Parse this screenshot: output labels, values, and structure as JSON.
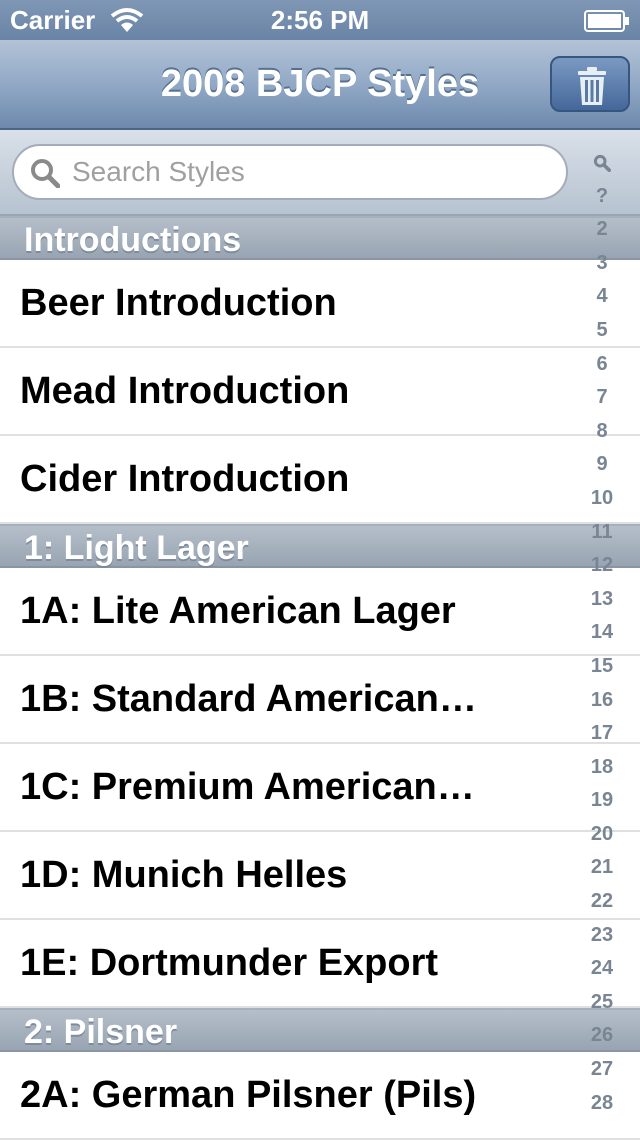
{
  "status_bar": {
    "carrier": "Carrier",
    "time": "2:56 PM"
  },
  "nav": {
    "title": "2008 BJCP Styles",
    "trash_icon": "trash-icon"
  },
  "search": {
    "placeholder": "Search Styles",
    "value": "",
    "icon": "search-icon"
  },
  "sections": [
    {
      "header": "Introductions",
      "rows": [
        "Beer Introduction",
        "Mead Introduction",
        "Cider Introduction"
      ]
    },
    {
      "header": "1: Light Lager",
      "rows": [
        "1A: Lite American Lager",
        "1B: Standard American…",
        "1C: Premium American…",
        "1D: Munich Helles",
        "1E: Dortmunder Export"
      ]
    },
    {
      "header": "2: Pilsner",
      "rows": [
        "2A: German Pilsner (Pils)"
      ]
    }
  ],
  "index": [
    "?",
    "2",
    "3",
    "4",
    "5",
    "6",
    "7",
    "8",
    "9",
    "10",
    "11",
    "12",
    "13",
    "14",
    "15",
    "16",
    "17",
    "18",
    "19",
    "20",
    "21",
    "22",
    "23",
    "24",
    "25",
    "26",
    "27",
    "28"
  ],
  "index_search_icon": "search-icon",
  "colors": {
    "nav_gradient_top": "#b3c3d7",
    "nav_gradient_bottom": "#6d89ad",
    "section_header": "#a6b1bd",
    "index_text": "#7a8593"
  }
}
